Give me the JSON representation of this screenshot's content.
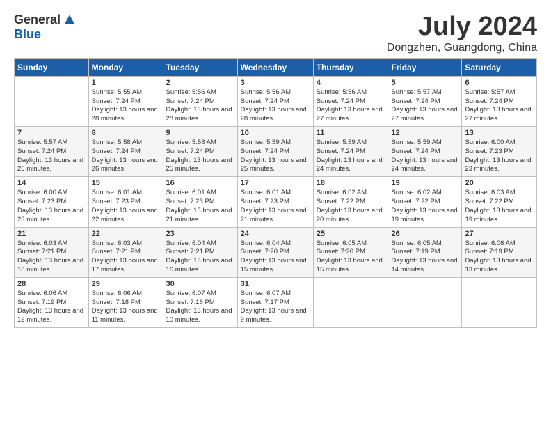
{
  "logo": {
    "general": "General",
    "blue": "Blue"
  },
  "title": "July 2024",
  "subtitle": "Dongzhen, Guangdong, China",
  "weekdays": [
    "Sunday",
    "Monday",
    "Tuesday",
    "Wednesday",
    "Thursday",
    "Friday",
    "Saturday"
  ],
  "weeks": [
    [
      {
        "day": "",
        "sunrise": "",
        "sunset": "",
        "daylight": ""
      },
      {
        "day": "1",
        "sunrise": "Sunrise: 5:55 AM",
        "sunset": "Sunset: 7:24 PM",
        "daylight": "Daylight: 13 hours and 28 minutes."
      },
      {
        "day": "2",
        "sunrise": "Sunrise: 5:56 AM",
        "sunset": "Sunset: 7:24 PM",
        "daylight": "Daylight: 13 hours and 28 minutes."
      },
      {
        "day": "3",
        "sunrise": "Sunrise: 5:56 AM",
        "sunset": "Sunset: 7:24 PM",
        "daylight": "Daylight: 13 hours and 28 minutes."
      },
      {
        "day": "4",
        "sunrise": "Sunrise: 5:56 AM",
        "sunset": "Sunset: 7:24 PM",
        "daylight": "Daylight: 13 hours and 27 minutes."
      },
      {
        "day": "5",
        "sunrise": "Sunrise: 5:57 AM",
        "sunset": "Sunset: 7:24 PM",
        "daylight": "Daylight: 13 hours and 27 minutes."
      },
      {
        "day": "6",
        "sunrise": "Sunrise: 5:57 AM",
        "sunset": "Sunset: 7:24 PM",
        "daylight": "Daylight: 13 hours and 27 minutes."
      }
    ],
    [
      {
        "day": "7",
        "sunrise": "Sunrise: 5:57 AM",
        "sunset": "Sunset: 7:24 PM",
        "daylight": "Daylight: 13 hours and 26 minutes."
      },
      {
        "day": "8",
        "sunrise": "Sunrise: 5:58 AM",
        "sunset": "Sunset: 7:24 PM",
        "daylight": "Daylight: 13 hours and 26 minutes."
      },
      {
        "day": "9",
        "sunrise": "Sunrise: 5:58 AM",
        "sunset": "Sunset: 7:24 PM",
        "daylight": "Daylight: 13 hours and 25 minutes."
      },
      {
        "day": "10",
        "sunrise": "Sunrise: 5:59 AM",
        "sunset": "Sunset: 7:24 PM",
        "daylight": "Daylight: 13 hours and 25 minutes."
      },
      {
        "day": "11",
        "sunrise": "Sunrise: 5:59 AM",
        "sunset": "Sunset: 7:24 PM",
        "daylight": "Daylight: 13 hours and 24 minutes."
      },
      {
        "day": "12",
        "sunrise": "Sunrise: 5:59 AM",
        "sunset": "Sunset: 7:24 PM",
        "daylight": "Daylight: 13 hours and 24 minutes."
      },
      {
        "day": "13",
        "sunrise": "Sunrise: 6:00 AM",
        "sunset": "Sunset: 7:23 PM",
        "daylight": "Daylight: 13 hours and 23 minutes."
      }
    ],
    [
      {
        "day": "14",
        "sunrise": "Sunrise: 6:00 AM",
        "sunset": "Sunset: 7:23 PM",
        "daylight": "Daylight: 13 hours and 23 minutes."
      },
      {
        "day": "15",
        "sunrise": "Sunrise: 6:01 AM",
        "sunset": "Sunset: 7:23 PM",
        "daylight": "Daylight: 13 hours and 22 minutes."
      },
      {
        "day": "16",
        "sunrise": "Sunrise: 6:01 AM",
        "sunset": "Sunset: 7:23 PM",
        "daylight": "Daylight: 13 hours and 21 minutes."
      },
      {
        "day": "17",
        "sunrise": "Sunrise: 6:01 AM",
        "sunset": "Sunset: 7:23 PM",
        "daylight": "Daylight: 13 hours and 21 minutes."
      },
      {
        "day": "18",
        "sunrise": "Sunrise: 6:02 AM",
        "sunset": "Sunset: 7:22 PM",
        "daylight": "Daylight: 13 hours and 20 minutes."
      },
      {
        "day": "19",
        "sunrise": "Sunrise: 6:02 AM",
        "sunset": "Sunset: 7:22 PM",
        "daylight": "Daylight: 13 hours and 19 minutes."
      },
      {
        "day": "20",
        "sunrise": "Sunrise: 6:03 AM",
        "sunset": "Sunset: 7:22 PM",
        "daylight": "Daylight: 13 hours and 19 minutes."
      }
    ],
    [
      {
        "day": "21",
        "sunrise": "Sunrise: 6:03 AM",
        "sunset": "Sunset: 7:21 PM",
        "daylight": "Daylight: 13 hours and 18 minutes."
      },
      {
        "day": "22",
        "sunrise": "Sunrise: 6:03 AM",
        "sunset": "Sunset: 7:21 PM",
        "daylight": "Daylight: 13 hours and 17 minutes."
      },
      {
        "day": "23",
        "sunrise": "Sunrise: 6:04 AM",
        "sunset": "Sunset: 7:21 PM",
        "daylight": "Daylight: 13 hours and 16 minutes."
      },
      {
        "day": "24",
        "sunrise": "Sunrise: 6:04 AM",
        "sunset": "Sunset: 7:20 PM",
        "daylight": "Daylight: 13 hours and 15 minutes."
      },
      {
        "day": "25",
        "sunrise": "Sunrise: 6:05 AM",
        "sunset": "Sunset: 7:20 PM",
        "daylight": "Daylight: 13 hours and 15 minutes."
      },
      {
        "day": "26",
        "sunrise": "Sunrise: 6:05 AM",
        "sunset": "Sunset: 7:19 PM",
        "daylight": "Daylight: 13 hours and 14 minutes."
      },
      {
        "day": "27",
        "sunrise": "Sunrise: 6:06 AM",
        "sunset": "Sunset: 7:19 PM",
        "daylight": "Daylight: 13 hours and 13 minutes."
      }
    ],
    [
      {
        "day": "28",
        "sunrise": "Sunrise: 6:06 AM",
        "sunset": "Sunset: 7:19 PM",
        "daylight": "Daylight: 13 hours and 12 minutes."
      },
      {
        "day": "29",
        "sunrise": "Sunrise: 6:06 AM",
        "sunset": "Sunset: 7:18 PM",
        "daylight": "Daylight: 13 hours and 11 minutes."
      },
      {
        "day": "30",
        "sunrise": "Sunrise: 6:07 AM",
        "sunset": "Sunset: 7:18 PM",
        "daylight": "Daylight: 13 hours and 10 minutes."
      },
      {
        "day": "31",
        "sunrise": "Sunrise: 6:07 AM",
        "sunset": "Sunset: 7:17 PM",
        "daylight": "Daylight: 13 hours and 9 minutes."
      },
      {
        "day": "",
        "sunrise": "",
        "sunset": "",
        "daylight": ""
      },
      {
        "day": "",
        "sunrise": "",
        "sunset": "",
        "daylight": ""
      },
      {
        "day": "",
        "sunrise": "",
        "sunset": "",
        "daylight": ""
      }
    ]
  ]
}
